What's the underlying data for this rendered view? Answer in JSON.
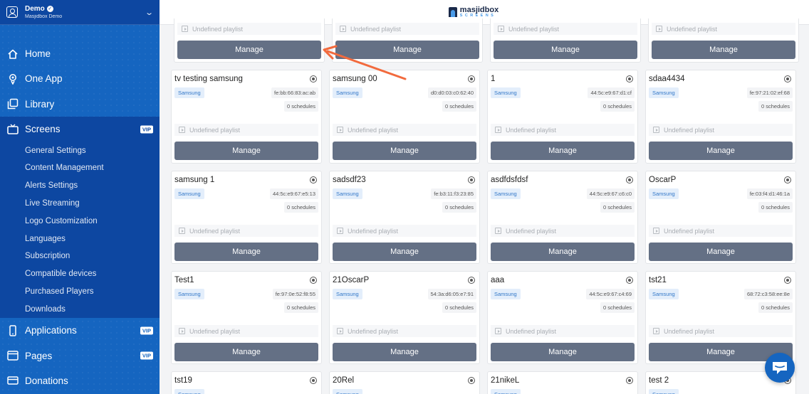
{
  "account": {
    "name": "Demo",
    "subtitle": "Masjidbox Demo"
  },
  "brand": {
    "name": "masjidbox",
    "tagline": "SCREENS"
  },
  "nav": {
    "home": "Home",
    "one_app": "One App",
    "library": "Library",
    "screens": "Screens",
    "applications": "Applications",
    "pages": "Pages",
    "donations": "Donations",
    "vip": "VIP"
  },
  "subnav": [
    "General Settings",
    "Content Management",
    "Alerts Settings",
    "Live Streaming",
    "Logo Customization",
    "Languages",
    "Subscription",
    "Compatible devices",
    "Purchased Players",
    "Downloads"
  ],
  "common": {
    "badge": "Samsung",
    "schedules": "0 schedules",
    "playlist": "Undefined playlist",
    "manage": "Manage"
  },
  "top_row": [
    {
      "playlist": "Undefined playlist"
    },
    {
      "playlist": "Undefined playlist"
    },
    {
      "playlist": "Undefined playlist"
    },
    {
      "playlist": "Undefined playlist"
    }
  ],
  "rows": [
    [
      {
        "title": "tv testing samsung",
        "mac": "fe:bb:66:83:ac:ab"
      },
      {
        "title": "samsung 00",
        "mac": "d0:d0:03:c0:62:40"
      },
      {
        "title": "1",
        "mac": "44:5c:e9:67:d1:cf"
      },
      {
        "title": "sdaa4434",
        "mac": "fe:97:21:02:ef:68"
      }
    ],
    [
      {
        "title": "samsung 1",
        "mac": "44:5c:e9:67:e5:13"
      },
      {
        "title": "sadsdf23",
        "mac": "fe:b3:11:f3:23:85"
      },
      {
        "title": "asdfdsfdsf",
        "mac": "44:5c:e9:67:c6:c0"
      },
      {
        "title": "OscarP",
        "mac": "fe:03:f4:d1:46:1a"
      }
    ],
    [
      {
        "title": "Test1",
        "mac": "fe:97:0e:52:f8:55"
      },
      {
        "title": "21OscarP",
        "mac": "54:3a:d6:05:e7:91"
      },
      {
        "title": "aaa",
        "mac": "44:5c:e9:67:c4:69"
      },
      {
        "title": "tst21",
        "mac": "68:72:c3:58:ee:8e"
      }
    ],
    [
      {
        "title": "tst19"
      },
      {
        "title": "20Rel"
      },
      {
        "title": "21nikeL"
      },
      {
        "title": "test 2"
      }
    ]
  ],
  "colors": {
    "sidebar": "#1565c0",
    "sidebar_active": "#0d47a1",
    "manage_button": "#647085",
    "annotation_arrow": "#f26a3d"
  }
}
